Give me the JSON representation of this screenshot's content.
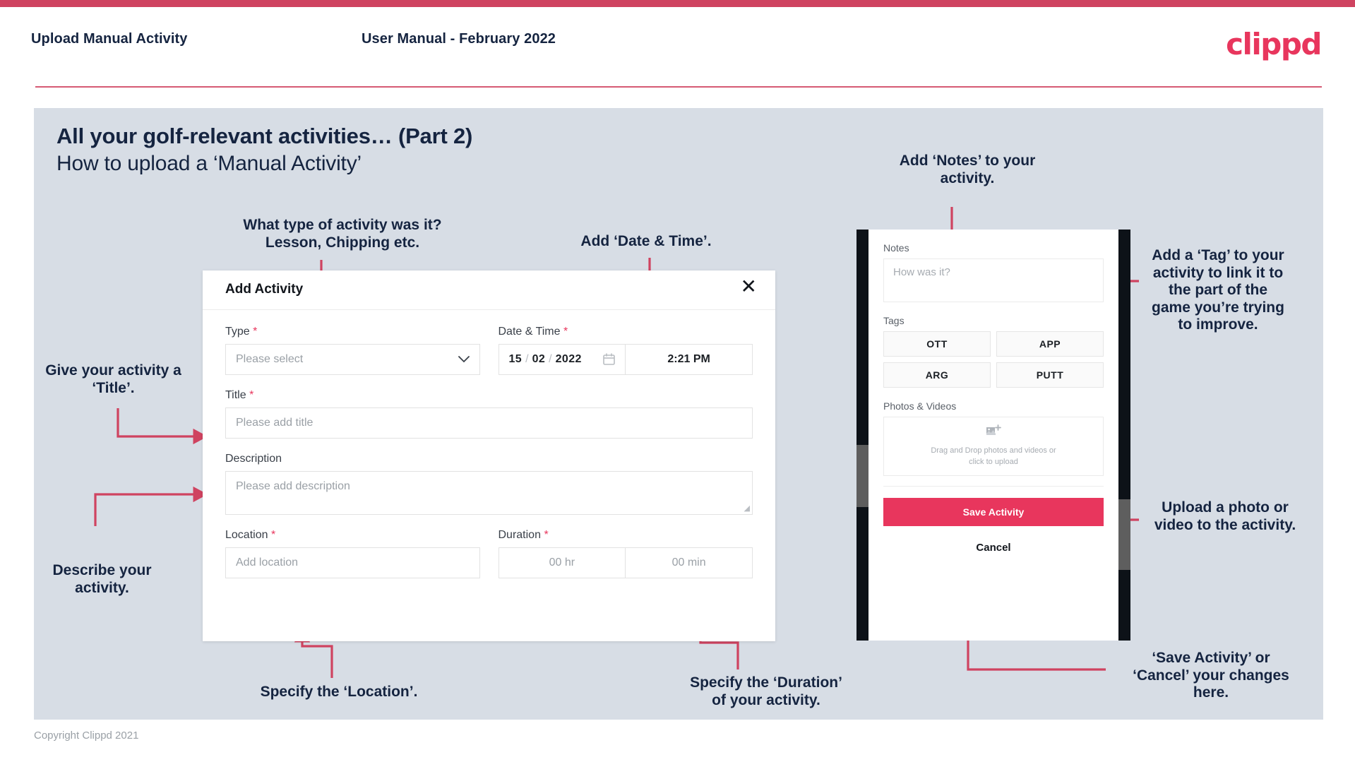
{
  "header": {
    "left_title": "Upload Manual Activity",
    "center_title": "User Manual - February 2022",
    "brand": "clippd"
  },
  "slide": {
    "title": "All your golf-relevant activities… (Part 2)",
    "subtitle": "How to upload a ‘Manual Activity’"
  },
  "annotations": {
    "type": "What type of activity was it?\nLesson, Chipping etc.",
    "datetime": "Add ‘Date & Time’.",
    "title": "Give your activity a\n‘Title’.",
    "description": "Describe your\nactivity.",
    "location": "Specify the ‘Location’.",
    "duration": "Specify the ‘Duration’\nof your activity.",
    "notes": "Add ‘Notes’ to your\nactivity.",
    "tags": "Add a ‘Tag’ to your\nactivity to link it to\nthe part of the\ngame you’re trying\nto improve.",
    "photos": "Upload a photo or\nvideo to the activity.",
    "save": "‘Save Activity’ or\n‘Cancel’ your changes\nhere."
  },
  "modal": {
    "title": "Add Activity",
    "close_icon": "close-icon",
    "fields": {
      "type": {
        "label": "Type",
        "required_marker": "*",
        "placeholder": "Please select",
        "chevron_icon": "chevron-down-icon"
      },
      "datetime": {
        "label": "Date & Time",
        "required_marker": "*",
        "day": "15",
        "month": "02",
        "year": "2022",
        "separator": "/",
        "calendar_icon": "calendar-icon",
        "time": "2:21 PM"
      },
      "title": {
        "label": "Title",
        "required_marker": "*",
        "placeholder": "Please add title"
      },
      "description": {
        "label": "Description",
        "placeholder": "Please add description"
      },
      "location": {
        "label": "Location",
        "required_marker": "*",
        "placeholder": "Add location"
      },
      "duration": {
        "label": "Duration",
        "required_marker": "*",
        "hours_placeholder": "00 hr",
        "minutes_placeholder": "00 min"
      }
    }
  },
  "phone": {
    "notes": {
      "label": "Notes",
      "placeholder": "How was it?"
    },
    "tags": {
      "label": "Tags",
      "items": [
        "OTT",
        "APP",
        "ARG",
        "PUTT"
      ]
    },
    "photos": {
      "label": "Photos & Videos",
      "icon": "add-photo-icon",
      "dropzone_text": "Drag and Drop photos and videos or\nclick to upload"
    },
    "save_label": "Save Activity",
    "cancel_label": "Cancel"
  },
  "footer": {
    "copyright": "Copyright Clippd 2021"
  },
  "colors": {
    "brand_pink": "#e8365d",
    "top_bar": "#cf4360",
    "arrow": "#cf4360",
    "slide_bg": "#d7dde5",
    "text_dark": "#152440"
  }
}
